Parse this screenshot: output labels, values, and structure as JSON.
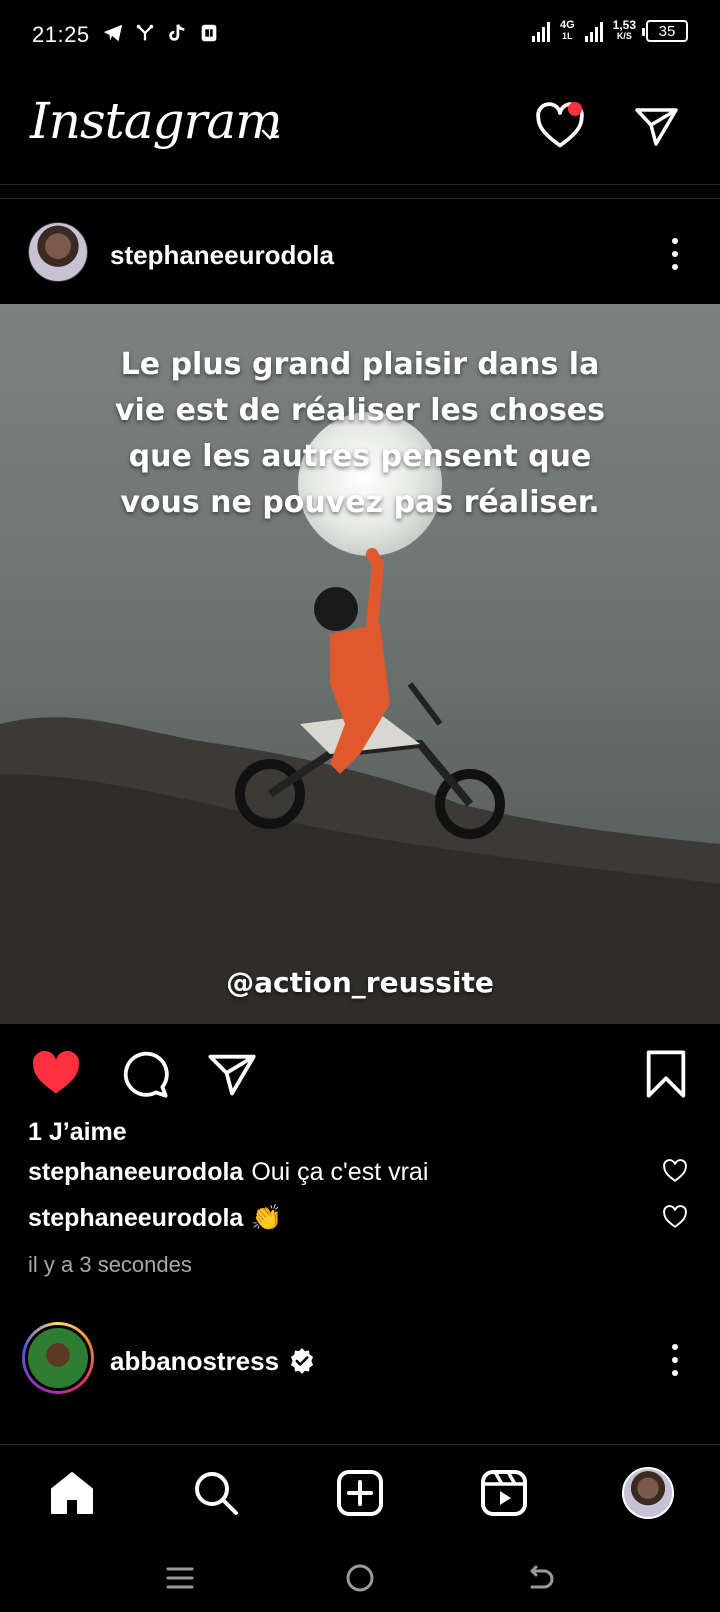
{
  "status_bar": {
    "time": "21:25",
    "network": "4G",
    "network_sub": "1L",
    "speed_value": "1,53",
    "speed_unit": "K/S",
    "battery": "35"
  },
  "header": {
    "logo_text": "Instagram",
    "has_notification": true,
    "notification_color": "#ff3040"
  },
  "post": {
    "username": "stephaneeurodola",
    "image": {
      "quote": "Le plus grand plaisir dans la vie est de réaliser les choses que les autres pensent que vous ne pouvez pas réaliser.",
      "watermark": "@action_reussite"
    },
    "likes": "1 J’aime",
    "liked": true,
    "like_color": "#ff3040",
    "comments": [
      {
        "user": "stephaneeurodola",
        "text": "Oui ça c'est vrai"
      },
      {
        "user": "stephaneeurodola",
        "text": "👏"
      }
    ],
    "timestamp": "il y a 3 secondes"
  },
  "next_post": {
    "username": "abbanostress",
    "verified": true
  },
  "icons": {
    "status_left": [
      "telegram-icon",
      "fork-icon",
      "tiktok-icon",
      "sim-icon"
    ],
    "actions": [
      "heart-icon",
      "comment-icon",
      "share-icon",
      "bookmark-icon"
    ],
    "nav": [
      "home-icon",
      "search-icon",
      "create-icon",
      "reels-icon",
      "profile-avatar"
    ],
    "system": [
      "menu-icon",
      "home-circle-icon",
      "back-icon"
    ]
  }
}
